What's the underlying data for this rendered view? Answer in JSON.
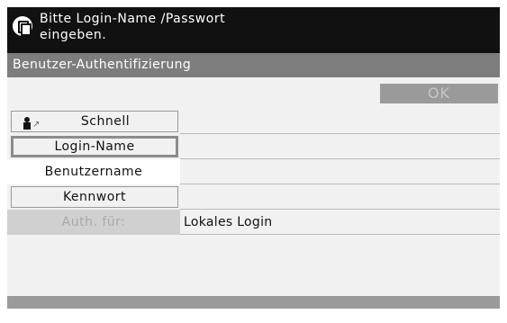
{
  "message": {
    "icon": "copy-pages-icon",
    "line1": "Bitte Login-Name /Passwort",
    "line2": "eingeben."
  },
  "title": "Benutzer-Authentifizierung",
  "ok_label": "OK",
  "rows": {
    "quick": {
      "label": "Schnell",
      "icon": "person-arrow-icon"
    },
    "login_name": {
      "label": "Login-Name"
    },
    "username": {
      "label": "Benutzername"
    },
    "password": {
      "label": "Kennwort"
    },
    "auth_for": {
      "label": "Auth. für:",
      "value": "Lokales Login"
    }
  },
  "colors": {
    "message_bg": "#111111",
    "title_bg": "#7d7d7d",
    "screen_bg": "#f1f1f1",
    "disabled_bg": "#d0d0d0",
    "ok_bg": "#9a9a9a"
  }
}
